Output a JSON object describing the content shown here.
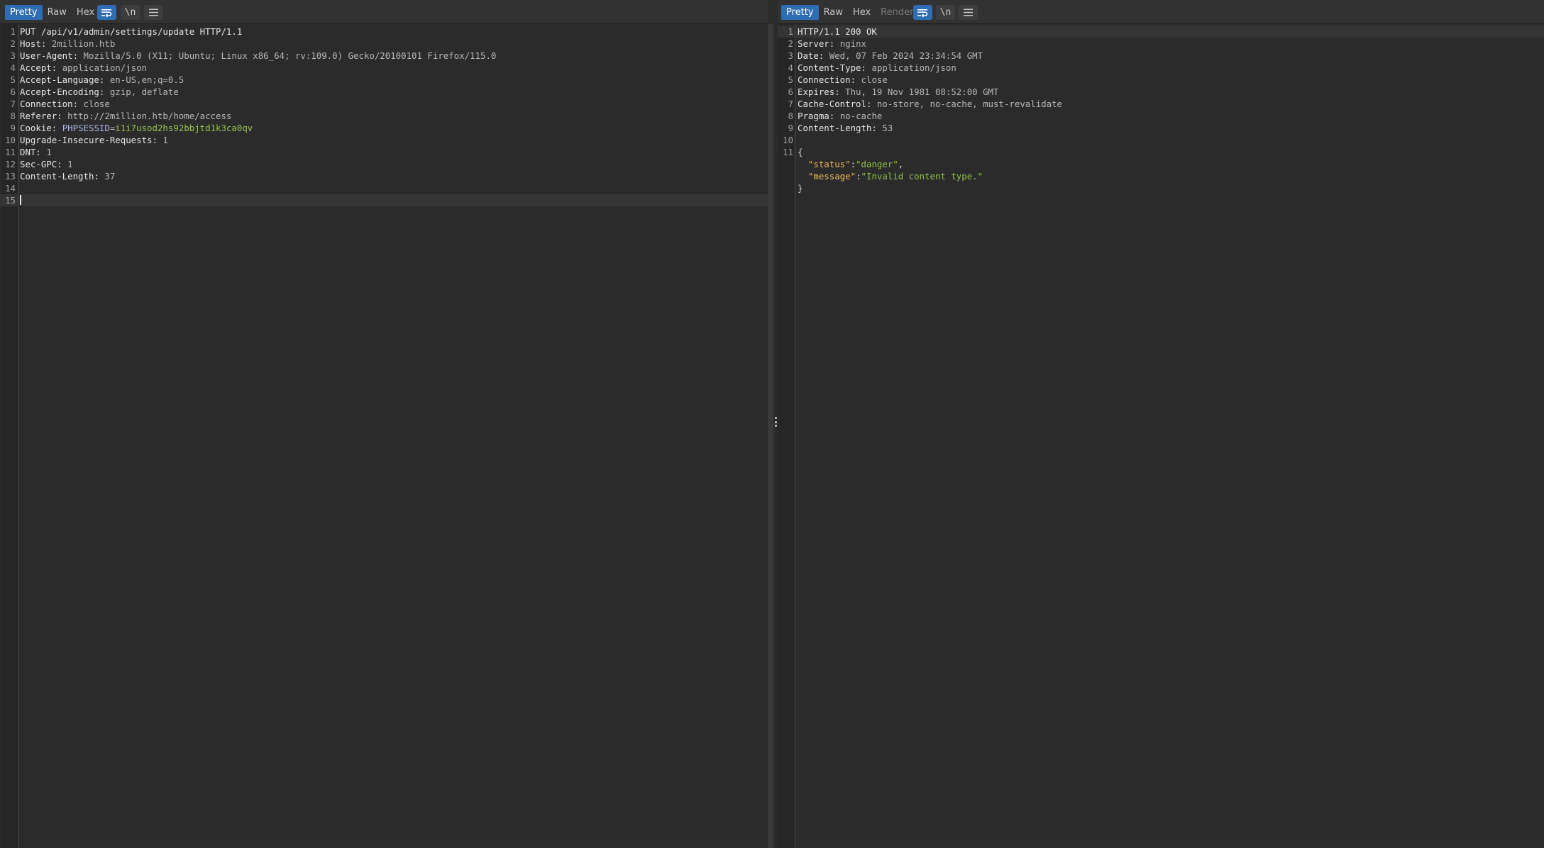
{
  "request_pane": {
    "tabs": [
      {
        "label": "Pretty",
        "active": true
      },
      {
        "label": "Raw",
        "active": false
      },
      {
        "label": "Hex",
        "active": false
      }
    ],
    "buttons": {
      "wrap_icon": "wrap-lines-icon",
      "newline_label": "\\n",
      "menu_icon": "hamburger-menu-icon"
    },
    "lines": [
      {
        "n": "1",
        "parts": [
          {
            "t": "PUT /api/v1/admin/settings/update HTTP/1.1",
            "c": "k"
          }
        ]
      },
      {
        "n": "2",
        "parts": [
          {
            "t": "Host: ",
            "c": "k"
          },
          {
            "t": "2million.htb",
            "c": "v"
          }
        ]
      },
      {
        "n": "3",
        "parts": [
          {
            "t": "User-Agent: ",
            "c": "k"
          },
          {
            "t": "Mozilla/5.0 (X11; Ubuntu; Linux x86_64; rv:109.0) Gecko/20100101 Firefox/115.0",
            "c": "v"
          }
        ]
      },
      {
        "n": "4",
        "parts": [
          {
            "t": "Accept: ",
            "c": "k"
          },
          {
            "t": "application/json",
            "c": "v"
          }
        ]
      },
      {
        "n": "5",
        "parts": [
          {
            "t": "Accept-Language: ",
            "c": "k"
          },
          {
            "t": "en-US,en;q=0.5",
            "c": "v"
          }
        ]
      },
      {
        "n": "6",
        "parts": [
          {
            "t": "Accept-Encoding: ",
            "c": "k"
          },
          {
            "t": "gzip, deflate",
            "c": "v"
          }
        ]
      },
      {
        "n": "7",
        "parts": [
          {
            "t": "Connection: ",
            "c": "k"
          },
          {
            "t": "close",
            "c": "v"
          }
        ]
      },
      {
        "n": "8",
        "parts": [
          {
            "t": "Referer: ",
            "c": "k"
          },
          {
            "t": "http://2million.htb/home/access",
            "c": "v"
          }
        ]
      },
      {
        "n": "9",
        "parts": [
          {
            "t": "Cookie: ",
            "c": "k"
          },
          {
            "t": "PHPSESSID",
            "c": "ck"
          },
          {
            "t": "=",
            "c": "v"
          },
          {
            "t": "i1i7usod2hs92bbjtd1k3ca0qv",
            "c": "cv"
          }
        ]
      },
      {
        "n": "10",
        "parts": [
          {
            "t": "Upgrade-Insecure-Requests: ",
            "c": "k"
          },
          {
            "t": "1",
            "c": "v"
          }
        ]
      },
      {
        "n": "11",
        "parts": [
          {
            "t": "DNT: ",
            "c": "k"
          },
          {
            "t": "1",
            "c": "v"
          }
        ]
      },
      {
        "n": "12",
        "parts": [
          {
            "t": "Sec-GPC: ",
            "c": "k"
          },
          {
            "t": "1",
            "c": "v"
          }
        ]
      },
      {
        "n": "13",
        "parts": [
          {
            "t": "Content-Length: ",
            "c": "k"
          },
          {
            "t": "37",
            "c": "v"
          }
        ]
      },
      {
        "n": "14",
        "parts": []
      },
      {
        "n": "15",
        "parts": [],
        "current": true,
        "caret": true
      }
    ]
  },
  "response_pane": {
    "tabs": [
      {
        "label": "Pretty",
        "active": true
      },
      {
        "label": "Raw",
        "active": false
      },
      {
        "label": "Hex",
        "active": false
      },
      {
        "label": "Render",
        "active": false,
        "disabled": true
      }
    ],
    "buttons": {
      "wrap_icon": "wrap-lines-icon",
      "newline_label": "\\n",
      "menu_icon": "hamburger-menu-icon"
    },
    "lines": [
      {
        "n": "1",
        "parts": [
          {
            "t": "HTTP/1.1 200 OK",
            "c": "k"
          }
        ],
        "current": true
      },
      {
        "n": "2",
        "parts": [
          {
            "t": "Server: ",
            "c": "k"
          },
          {
            "t": "nginx",
            "c": "v"
          }
        ]
      },
      {
        "n": "3",
        "parts": [
          {
            "t": "Date: ",
            "c": "k"
          },
          {
            "t": "Wed, 07 Feb 2024 23:34:54 GMT",
            "c": "v"
          }
        ]
      },
      {
        "n": "4",
        "parts": [
          {
            "t": "Content-Type: ",
            "c": "k"
          },
          {
            "t": "application/json",
            "c": "v"
          }
        ]
      },
      {
        "n": "5",
        "parts": [
          {
            "t": "Connection: ",
            "c": "k"
          },
          {
            "t": "close",
            "c": "v"
          }
        ]
      },
      {
        "n": "6",
        "parts": [
          {
            "t": "Expires: ",
            "c": "k"
          },
          {
            "t": "Thu, 19 Nov 1981 08:52:00 GMT",
            "c": "v"
          }
        ]
      },
      {
        "n": "7",
        "parts": [
          {
            "t": "Cache-Control: ",
            "c": "k"
          },
          {
            "t": "no-store, no-cache, must-revalidate",
            "c": "v"
          }
        ]
      },
      {
        "n": "8",
        "parts": [
          {
            "t": "Pragma: ",
            "c": "k"
          },
          {
            "t": "no-cache",
            "c": "v"
          }
        ]
      },
      {
        "n": "9",
        "parts": [
          {
            "t": "Content-Length: ",
            "c": "k"
          },
          {
            "t": "53",
            "c": "v"
          }
        ]
      },
      {
        "n": "10",
        "parts": []
      },
      {
        "n": "11",
        "parts": [
          {
            "t": "{",
            "c": "jp"
          }
        ]
      },
      {
        "n": "",
        "parts": [
          {
            "t": "  ",
            "c": "jp"
          },
          {
            "t": "\"status\"",
            "c": "jk"
          },
          {
            "t": ":",
            "c": "jp"
          },
          {
            "t": "\"danger\"",
            "c": "js"
          },
          {
            "t": ",",
            "c": "jp"
          }
        ]
      },
      {
        "n": "",
        "parts": [
          {
            "t": "  ",
            "c": "jp"
          },
          {
            "t": "\"message\"",
            "c": "jk"
          },
          {
            "t": ":",
            "c": "jp"
          },
          {
            "t": "\"Invalid content type.\"",
            "c": "js"
          }
        ]
      },
      {
        "n": "",
        "parts": [
          {
            "t": "}",
            "c": "jp"
          }
        ]
      }
    ]
  },
  "colors": {
    "accent": "#2f6db3",
    "background": "#2b2b2b",
    "header_key": "#e6e6e6",
    "header_value": "#b8b8b8",
    "cookie_name": "#aeb4e6",
    "cookie_value": "#9bc255",
    "json_key": "#f0b85a",
    "json_string": "#8fc04a"
  }
}
